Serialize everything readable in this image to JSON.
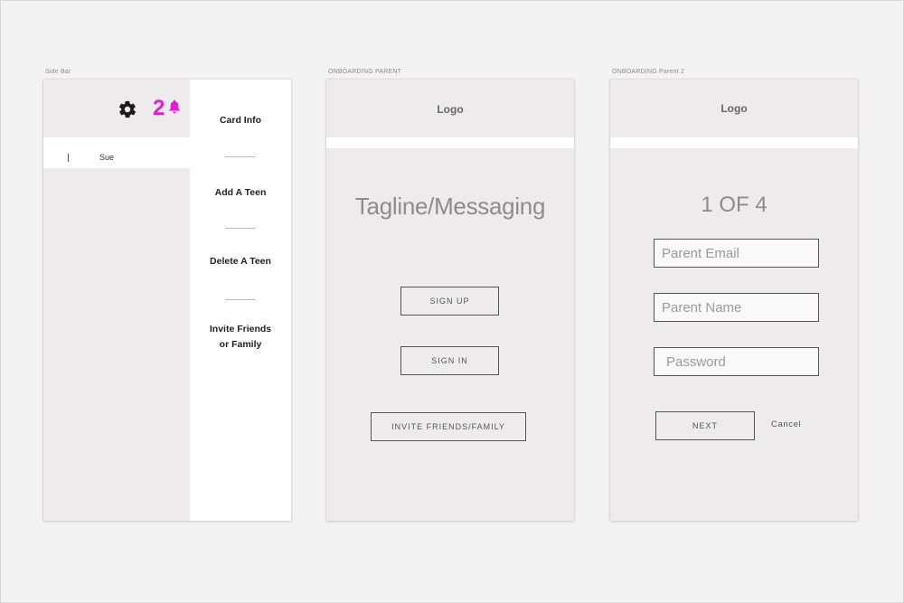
{
  "artboards": {
    "sidebar": {
      "title": "Side Bar",
      "notification_count": "2",
      "user_name": "Sue",
      "menu": {
        "card_info": "Card Info",
        "add_teen": "Add A Teen",
        "delete_teen": "Delete A Teen",
        "invite_line1": "Invite Friends",
        "invite_line2": "or Family"
      },
      "icons": {
        "settings": "gear-icon",
        "notifications": "bell-icon"
      },
      "colors": {
        "badge": "#e01ed0"
      }
    },
    "onboarding1": {
      "title": "ONBOARDING PARENT",
      "logo": "Logo",
      "tagline": "Tagline/Messaging",
      "sign_up": "SIGN UP",
      "sign_in": "SIGN IN",
      "invite": "INVITE FRIENDS/FAMILY"
    },
    "onboarding2": {
      "title": "ONBOARDING Parent 2",
      "logo": "Logo",
      "step": "1 OF 4",
      "fields": {
        "email_placeholder": "Parent Email",
        "name_placeholder": "Parent Name",
        "password_placeholder": "Password"
      },
      "next": "NEXT",
      "cancel": "Cancel"
    }
  }
}
